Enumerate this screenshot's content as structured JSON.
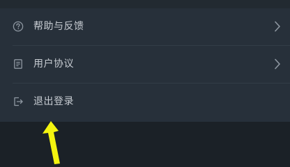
{
  "menu": {
    "items": [
      {
        "label": "帮助与反馈",
        "icon": "help-circle-icon",
        "has_chevron": true
      },
      {
        "label": "用户协议",
        "icon": "document-icon",
        "has_chevron": true
      },
      {
        "label": "退出登录",
        "icon": "logout-icon",
        "has_chevron": false
      }
    ]
  },
  "colors": {
    "page_background": "#1b2127",
    "panel_background": "#27303a",
    "divider": "#333d47",
    "text": "#c7ccd2",
    "icon": "#8f98a2",
    "annotation_arrow": "#f4f40f"
  },
  "annotation": {
    "icon": "yellow-arrow-icon"
  }
}
